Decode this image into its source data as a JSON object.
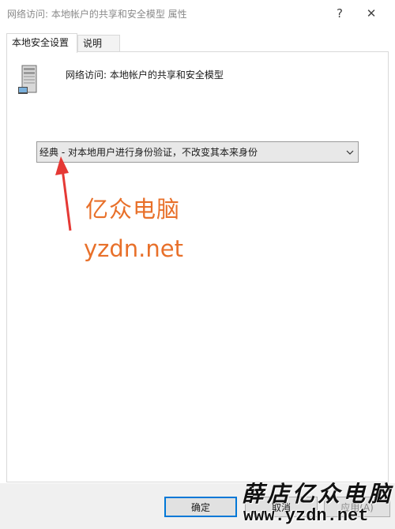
{
  "window": {
    "title": "网络访问: 本地帐户的共享和安全模型 属性",
    "help_label": "?",
    "close_label": "✕"
  },
  "tabs": [
    {
      "label": "本地安全设置",
      "active": true
    },
    {
      "label": "说明",
      "active": false
    }
  ],
  "policy": {
    "icon": "server-computer-icon",
    "name": "网络访问: 本地帐户的共享和安全模型"
  },
  "dropdown": {
    "selected": "经典 - 对本地用户进行身份验证，不改变其本来身份"
  },
  "annotation": {
    "arrow_color": "#e53935",
    "watermark_text": "亿众电脑",
    "watermark_url": "yzdn.net",
    "watermark_color": "#e8702a"
  },
  "buttons": {
    "ok": "确定",
    "cancel": "取消",
    "apply": "应用(A)"
  },
  "bottom_watermark": {
    "text": "薛店亿众电脑",
    "url": "www.yzdn.net"
  }
}
